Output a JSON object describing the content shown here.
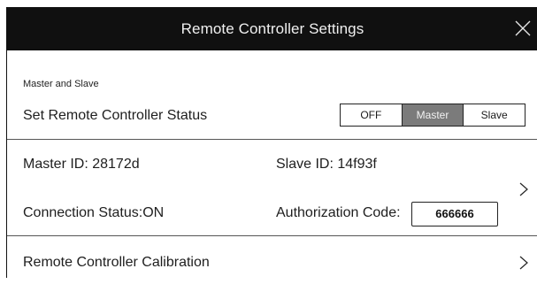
{
  "window": {
    "title": "Remote Controller Settings",
    "close_icon": "close-icon"
  },
  "master_slave": {
    "section_label": "Master and Slave",
    "status_label": "Set Remote Controller Status",
    "options": [
      "OFF",
      "Master",
      "Slave"
    ],
    "selected": "Master"
  },
  "info": {
    "master_id": "Master ID: 28172d",
    "slave_id": "Slave ID: 14f93f",
    "connection_status": "Connection Status:ON",
    "auth_label": "Authorization Code:",
    "auth_code": "666666",
    "chevron_icon": "chevron-right-icon"
  },
  "calibration": {
    "label": "Remote Controller Calibration",
    "chevron_icon": "chevron-right-icon"
  },
  "colors": {
    "titlebar": "#101010",
    "segment_active": "#7b7b7b"
  }
}
